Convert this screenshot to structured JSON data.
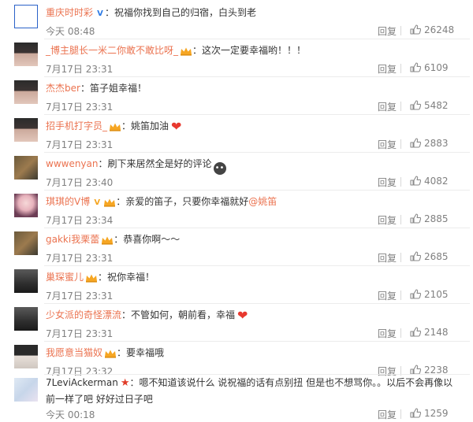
{
  "actions": {
    "reply_label": "回复"
  },
  "comments": [
    {
      "avatar": "avatar-logo-blue",
      "name": "重庆时时彩",
      "badge": "V",
      "badge_color": "#2d7be5",
      "text": "：祝福你找到自己的归宿，白头到老",
      "time": "今天 08:48",
      "likes": "26248"
    },
    {
      "avatar": "avatar-woman",
      "name": "_博主腿长一米二你敢不敢比呀_",
      "badge": "vip-icon",
      "text": "：这次一定要幸福哟！！！",
      "time": "7月17日 23:31",
      "likes": "6109"
    },
    {
      "avatar": "avatar-woman",
      "name": "杰杰ber",
      "text": "：笛子姐幸福！",
      "time": "7月17日 23:31",
      "likes": "5482"
    },
    {
      "avatar": "avatar-woman",
      "name": "招手机打字员_",
      "badge": "vip-icon",
      "text": "：姚笛加油",
      "emoji": "heart",
      "time": "7月17日 23:31",
      "likes": "2883"
    },
    {
      "avatar": "avatar-photo",
      "name": "wwwenyan",
      "text": "：刷下来居然全是好的评论",
      "emoji": "face",
      "time": "7月17日 23:40",
      "likes": "4082"
    },
    {
      "avatar": "avatar-cartoon",
      "name": "琪琪的V博",
      "badge": "V",
      "badge_color": "#f5a623",
      "badge2": "vip-icon",
      "text": "：亲爱的笛子，只要你幸福就好",
      "mention": "@姚笛",
      "time": "7月17日 23:34",
      "likes": "2885"
    },
    {
      "avatar": "avatar-photo",
      "name": "gakki我栗蕾",
      "badge": "vip-icon",
      "text": "：恭喜你啊～～",
      "time": "7月17日 23:31",
      "likes": "2685"
    },
    {
      "avatar": "avatar-dark",
      "name": "巢琛蜜儿",
      "badge": "vip-icon",
      "text": "：祝你幸福！",
      "time": "7月17日 23:31",
      "likes": "2105"
    },
    {
      "avatar": "avatar-dark",
      "name": "少女派的奇怪漂流",
      "text": "：不管如何，朝前看，幸福",
      "emoji": "heart",
      "time": "7月17日 23:31",
      "likes": "2148"
    },
    {
      "avatar": "avatar-boy",
      "name": "我愿意当猫奴",
      "badge": "vip-icon",
      "text": "：要幸福哦",
      "time": "7月17日 23:32",
      "likes": "2238"
    },
    {
      "avatar": "avatar-anime",
      "name": "7LeviAckerman",
      "badge": "star",
      "text": "：嗯不知道该说什么 说祝福的话有点别扭 但是也不想骂你。。以后不会再像以前一样了吧 好好过日子吧",
      "time": "今天 00:18",
      "likes": "1259"
    }
  ],
  "colors": {
    "name": "#eb7350",
    "meta": "#808080",
    "heart": "#e8392f"
  }
}
